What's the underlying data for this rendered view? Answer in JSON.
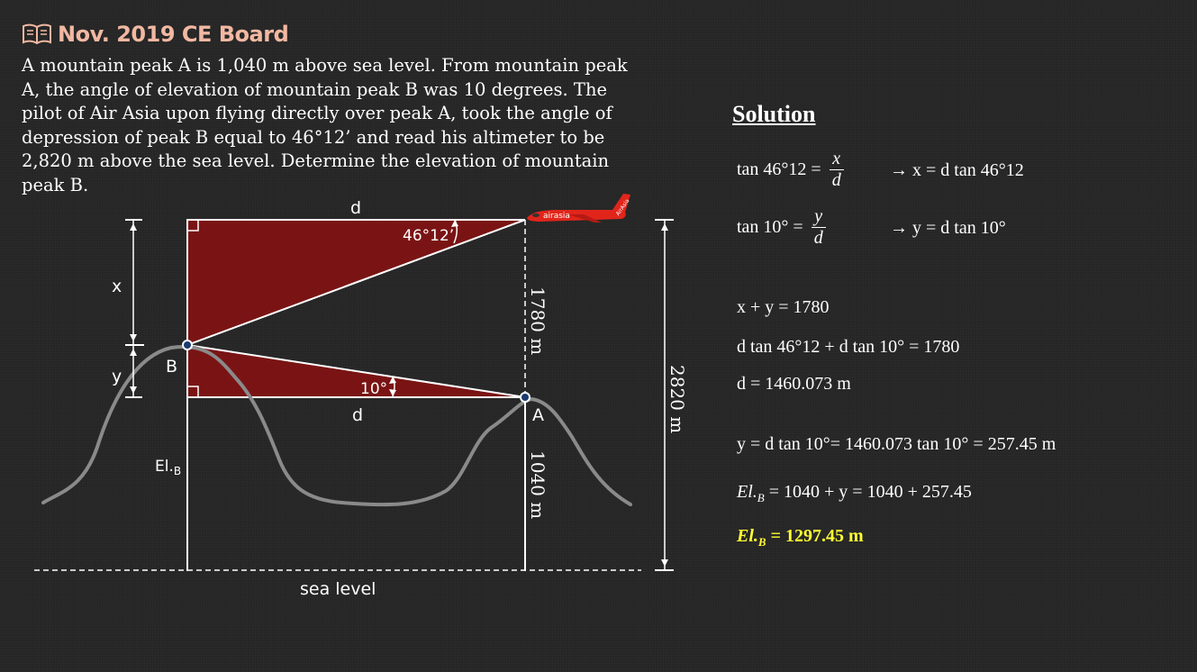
{
  "header": {
    "title": "Nov. 2019 CE Board",
    "icon": "book-icon"
  },
  "problem": {
    "lines": [
      "A mountain peak A is 1,040 m above sea level. From mountain peak",
      "A, the angle of elevation of mountain peak B was 10 degrees. The",
      "pilot of Air Asia upon flying directly over peak A, took the angle of",
      "depression of peak B equal to 46°12’ and read his altimeter to be",
      "2,820 m above the sea level. Determine the elevation of mountain",
      "peak B."
    ]
  },
  "diagram": {
    "labels": {
      "d_top": "d",
      "d_bottom": "d",
      "angle_depression": "46°12’",
      "angle_elevation": "10°",
      "x": "x",
      "y": "y",
      "B": "B",
      "A": "A",
      "elB": "El.",
      "elB_sub": "B",
      "dist_1780": "1780 m",
      "dist_1040": "1040 m",
      "dist_2820": "2820 m",
      "sea_level": "sea level",
      "airasia": "airasia",
      "tail_text": "AirAsia"
    },
    "colors": {
      "triangle": "#7a1414",
      "mountain": "#8a8a8a",
      "plane": "#e1251b"
    }
  },
  "solution": {
    "title": "Solution",
    "eq1_lhs": "tan 46°12 =",
    "eq1_num": "x",
    "eq1_den": "d",
    "eq1_rhs": "→ x = d tan 46°12",
    "eq2_lhs": "tan 10° =",
    "eq2_num": "y",
    "eq2_den": "d",
    "eq2_rhs": "→ y = d tan 10°",
    "eq3": "x + y = 1780",
    "eq4": "d tan 46°12 + d tan 10° = 1780",
    "eq5": "d = 1460.073 m",
    "eq6": "y = d tan 10°= 1460.073 tan 10° = 257.45 m",
    "eq7_lhs": "El.",
    "eq7_sub": "B",
    "eq7_rhs": " = 1040 + y  = 1040 + 257.45",
    "eq8_lhs": "El.",
    "eq8_sub": "B",
    "eq8_rhs": " = 1297.45 m"
  }
}
